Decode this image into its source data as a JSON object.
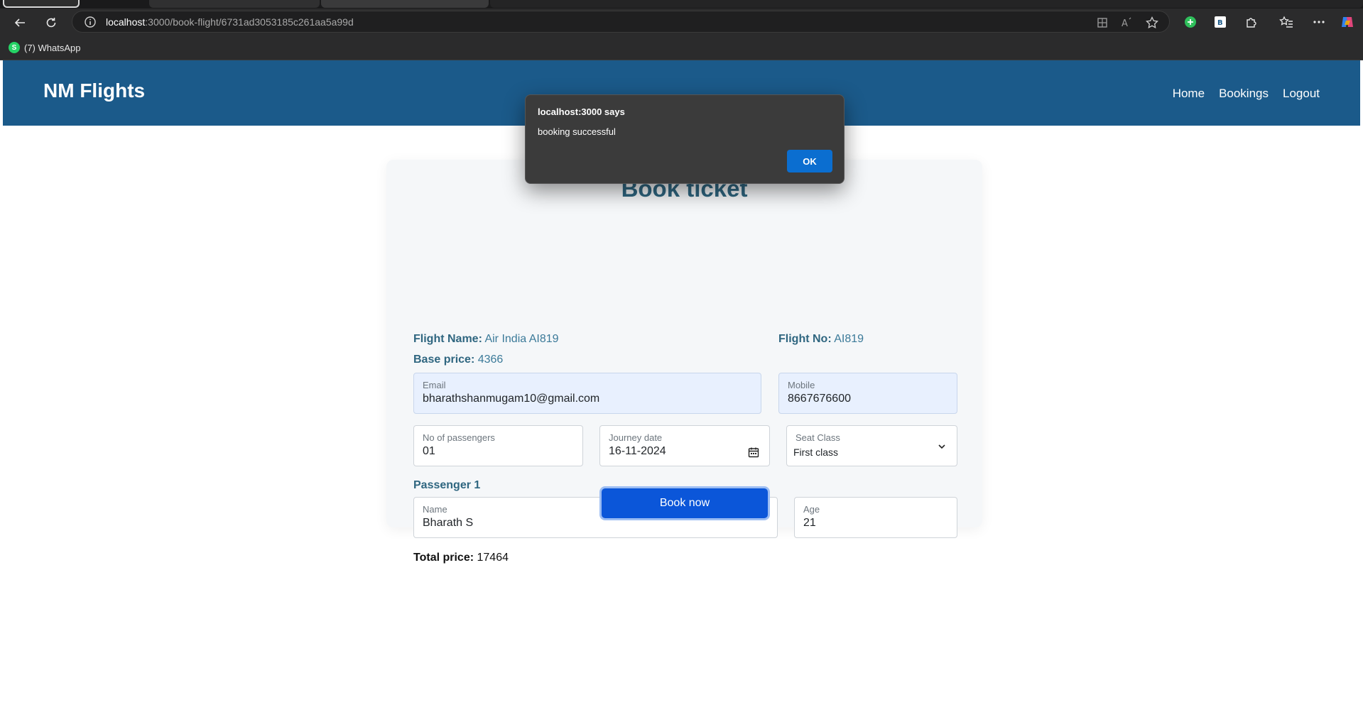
{
  "browser": {
    "url_host": "localhost",
    "url_rest": ":3000/book-flight/6731ad3053185c261aa5a99d",
    "bookmark_label": "(7) WhatsApp"
  },
  "dialog": {
    "title": "localhost:3000 says",
    "message": "booking successful",
    "ok_label": "OK"
  },
  "navbar": {
    "brand": "NM Flights",
    "links": [
      "Home",
      "Bookings",
      "Logout"
    ]
  },
  "form": {
    "title": "Book ticket",
    "flight_name_label": "Flight Name:",
    "flight_name": "Air India AI819",
    "flight_no_label": "Flight No:",
    "flight_no": "AI819",
    "base_price_label": "Base price:",
    "base_price": "4366",
    "email_label": "Email",
    "email_value": "bharathshanmugam10@gmail.com",
    "mobile_label": "Mobile",
    "mobile_value": "8667676600",
    "passengers_label": "No of passengers",
    "passengers_value": "01",
    "journey_date_label": "Journey date",
    "journey_date_value": "16-11-2024",
    "seat_class_label": "Seat Class",
    "seat_class_value": "First class",
    "passenger_heading": "Passenger 1",
    "name_label": "Name",
    "name_value": "Bharath S",
    "age_label": "Age",
    "age_value": "21",
    "total_label": "Total price:",
    "total_value": "17464",
    "submit_label": "Book now"
  }
}
